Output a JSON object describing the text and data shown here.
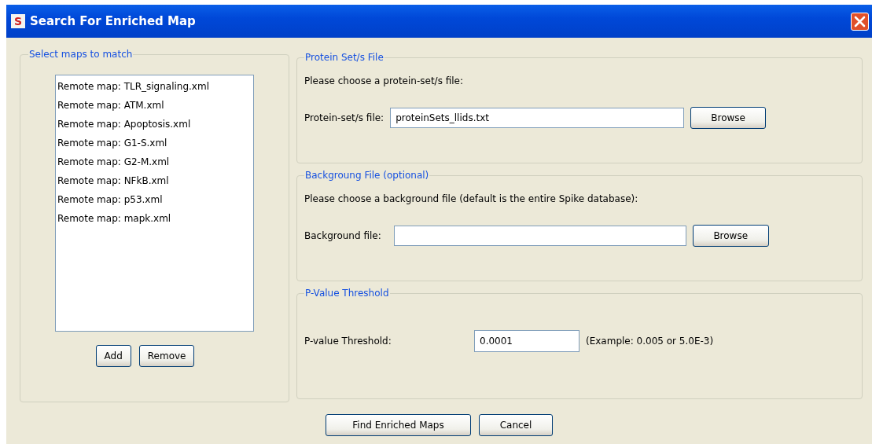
{
  "window": {
    "icon_letter": "S",
    "title": "Search For Enriched Map"
  },
  "maps_group": {
    "title": "Select maps to match",
    "items": [
      {
        "label": "Remote map: TLR_signaling.xml",
        "selected": false
      },
      {
        "label": "Remote map: ATM.xml",
        "selected": false
      },
      {
        "label": "Remote map: Apoptosis.xml",
        "selected": false
      },
      {
        "label": "Remote map: G1-S.xml",
        "selected": false
      },
      {
        "label": "Remote map: G2-M.xml",
        "selected": false
      },
      {
        "label": "Remote map: NFkB.xml",
        "selected": false
      },
      {
        "label": "Remote map: p53.xml",
        "selected": false
      },
      {
        "label": "Remote map: mapk.xml",
        "selected": false
      }
    ],
    "buttons": [
      "Add",
      "Remove"
    ]
  },
  "groups": [
    {
      "title": "Protein Set/s File",
      "prompt": "Please choose a protein-set/s file:",
      "label": "Protein-set/s file:",
      "value": "proteinSets_llids.txt",
      "button": "Browse"
    },
    {
      "title": "Backgroung File (optional)",
      "prompt": "Please choose a background file (default is the entire Spike database):",
      "label": "Background file:",
      "button": "Browse"
    },
    {
      "title": "P-Value Threshold",
      "label": "P-value Threshold:",
      "value": "0.0001",
      "hint": "(Example: 0.005 or 5.0E-3)"
    }
  ],
  "buttons": [
    "Find Enriched Maps",
    "Cancel"
  ]
}
